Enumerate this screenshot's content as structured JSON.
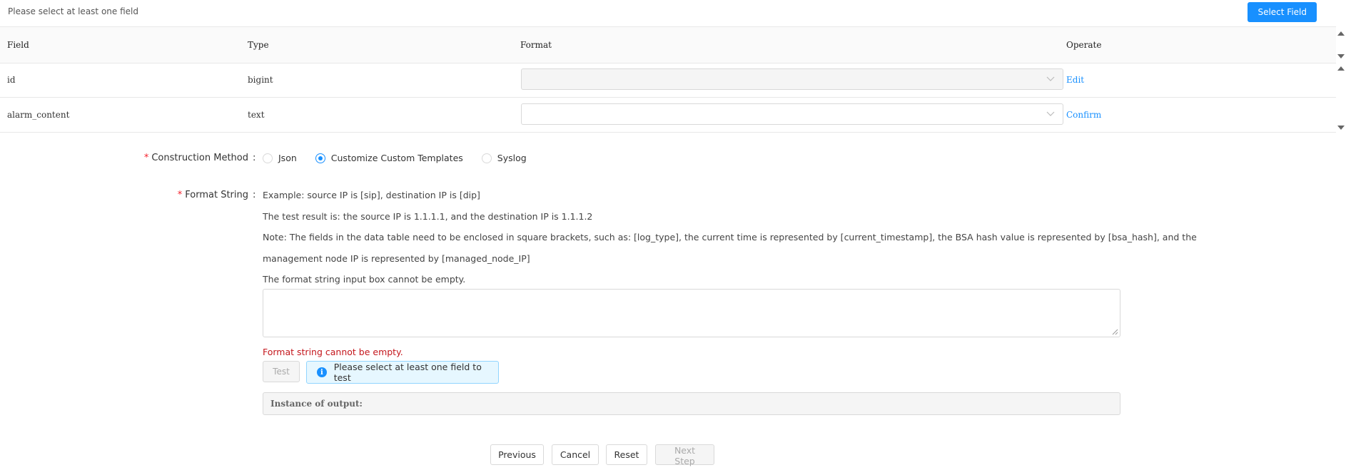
{
  "header": {
    "message": "Please select at least one field",
    "select_field_label": "Select Field"
  },
  "table": {
    "columns": [
      "Field",
      "Type",
      "Format",
      "Operate"
    ],
    "rows": [
      {
        "field": "id",
        "type": "bigint",
        "format": "",
        "operate": "Edit",
        "format_disabled": true
      },
      {
        "field": "alarm_content",
        "type": "text",
        "format": "",
        "operate": "Confirm",
        "format_disabled": false
      }
    ]
  },
  "form": {
    "construction_method": {
      "label": "Construction Method",
      "options": [
        "Json",
        "Customize Custom Templates",
        "Syslog"
      ],
      "selected": "Customize Custom Templates"
    },
    "format_string": {
      "label": "Format String",
      "notes": [
        "Example: source IP is [sip], destination IP is [dip]",
        "The test result is: the source IP is 1.1.1.1, and the destination IP is 1.1.1.2",
        "Note: The fields in the data table need to be enclosed in square brackets, such as: [log_type], the current time is represented by [current_timestamp], the BSA hash value is represented by [bsa_hash], and the",
        "management node IP is represented by [managed_node_IP]",
        "The format string input box cannot be empty."
      ],
      "value": "",
      "error": "Format string cannot be empty."
    },
    "test_label": "Test",
    "info_message": "Please select at least one field to test",
    "output_label": "Instance of output:"
  },
  "footer": {
    "previous": "Previous",
    "cancel": "Cancel",
    "reset": "Reset",
    "next_step": "Next Step"
  },
  "colors": {
    "primary": "#1890ff",
    "error": "#c4161c",
    "required": "#f5222d",
    "info_bg": "#e6f7ff"
  }
}
